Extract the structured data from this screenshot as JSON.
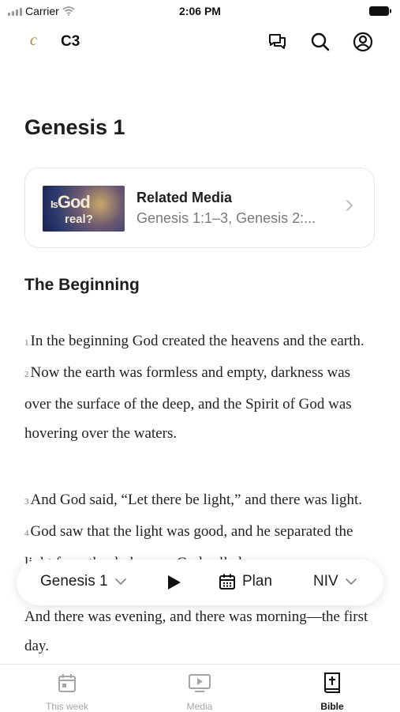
{
  "status": {
    "carrier": "Carrier",
    "time": "2:06 PM"
  },
  "header": {
    "logo": "c",
    "brand": "C3",
    "icons": [
      "chat-icon",
      "search-icon",
      "account-icon"
    ]
  },
  "page": {
    "title": "Genesis 1"
  },
  "related_media": {
    "thumb_line1_small": "Is",
    "thumb_line1": "God",
    "thumb_line2": "real?",
    "title": "Related Media",
    "subtitle": "Genesis 1:1–3, Genesis 2:..."
  },
  "section": {
    "heading": "The Beginning"
  },
  "verses": {
    "v1_num": "1",
    "v1": "In the beginning God created the heavens and the earth.",
    "v2_num": "2",
    "v2": "Now the earth was formless and empty, darkness was over the surface of the deep, and the Spirit of God was hovering over the waters.",
    "v3_num": "3",
    "v3": "And God said, “Let there be light,” and there was light.",
    "v4_num": "4",
    "v4": "God saw that the light was good, and he separated the light from the darkness.",
    "v5_num": "5",
    "v5": "God called",
    "v5_end": "And there was evening, and there was morning—the first day."
  },
  "toolbar": {
    "chapter": "Genesis 1",
    "plan": "Plan",
    "version": "NIV"
  },
  "tabs": [
    {
      "label": "This week",
      "icon": "calendar-icon",
      "active": false
    },
    {
      "label": "Media",
      "icon": "tv-play-icon",
      "active": false
    },
    {
      "label": "Bible",
      "icon": "bible-icon",
      "active": true
    }
  ]
}
